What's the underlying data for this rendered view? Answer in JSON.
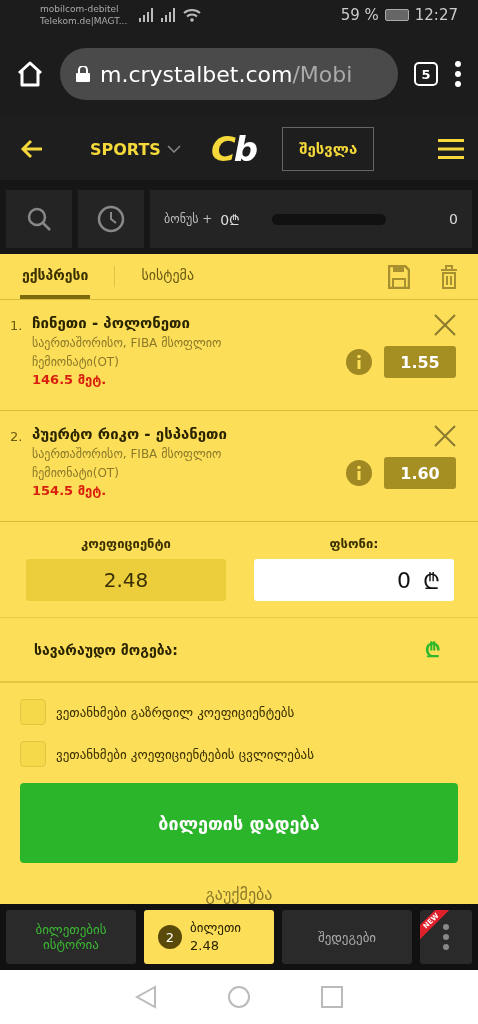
{
  "status_bar": {
    "carrier_1": "mobilcom-debitel",
    "carrier_2": "Telekom.de|MAGT...",
    "battery": "59 %",
    "time": "12:27"
  },
  "browser": {
    "url_host": "m.crystalbet.com",
    "url_path": "/Mobi",
    "tab_count": "5"
  },
  "header": {
    "sports": "SPORTS",
    "logo": "Cb",
    "login": "შესვლა"
  },
  "toolbar": {
    "bonus_label": "ბონუს +",
    "bonus_value": "0₾",
    "bonus_count": "0"
  },
  "tabs": [
    {
      "label": "ექსპრესი",
      "selected": true
    },
    {
      "label": "სისტემა",
      "selected": false
    }
  ],
  "bets": [
    {
      "number": "1.",
      "match": "ჩინეთი - პოლონეთი",
      "league": "საერთაშორისო, FIBA მსოფლიო ჩემიონატი(OT)",
      "market": "146.5 მეტ.",
      "odds": "1.55"
    },
    {
      "number": "2.",
      "match": "პუერტო რიკო - ესპანეთი",
      "league": "საერთაშორისო, FIBA მსოფლიო ჩემიონატი(OT)",
      "market": "154.5 მეტ.",
      "odds": "1.60"
    }
  ],
  "summary": {
    "odds_label": "კოეფიციენტი",
    "odds": "2.48",
    "stake_label": "ფსონი:",
    "stake": "0",
    "currency": "₾",
    "winnings_label": "სავარაუდო მოგება:",
    "winnings_currency": "₾"
  },
  "options": [
    {
      "label": "ვეთანხმები გაზრდილ კოეფიციენტებს",
      "checked": false
    },
    {
      "label": "ვეთანხმები კოეფიციენტების ცვლილებას",
      "checked": false
    }
  ],
  "place_button": "ბილეთის დადება",
  "cancel": "გაუქმება",
  "bottom_nav": {
    "history": "ბილეთების ისტორია",
    "slip": {
      "count": "2",
      "label": "ბილეთი",
      "odds": "2.48"
    },
    "results": "შედეგები",
    "more_badge": "NEW"
  }
}
